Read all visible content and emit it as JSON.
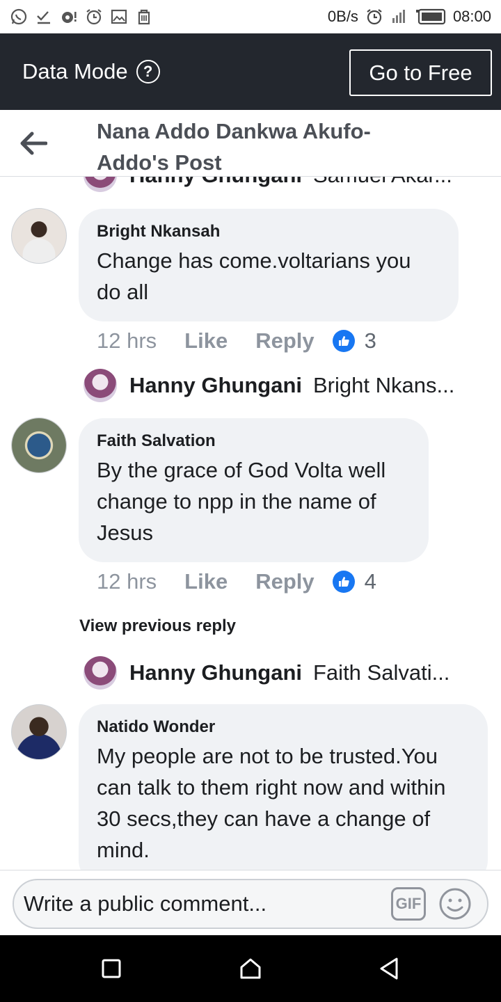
{
  "status_bar": {
    "speed": "0B/s",
    "time": "08:00"
  },
  "data_mode": {
    "label": "Data Mode",
    "help": "?",
    "go_free_label": "Go to Free"
  },
  "header": {
    "title": "Nana Addo Dankwa Akufo-Addo's Post"
  },
  "partial_reply": {
    "name": "Hanny Ghungani",
    "preview": "Samuel Akar..."
  },
  "comments": [
    {
      "author": "Bright Nkansah",
      "text": "Change has come.voltarians you do all",
      "time": "12 hrs",
      "like_label": "Like",
      "reply_label": "Reply",
      "like_count": "3",
      "reply_preview": {
        "name": "Hanny Ghungani",
        "preview": "Bright Nkans..."
      }
    },
    {
      "author": "Faith Salvation",
      "text": "By the grace of God Volta well change to npp in the name of Jesus",
      "time": "12 hrs",
      "like_label": "Like",
      "reply_label": "Reply",
      "like_count": "4",
      "view_previous": "View previous reply",
      "reply_preview": {
        "name": "Hanny Ghungani",
        "preview": "Faith Salvati..."
      }
    },
    {
      "author": "Natido Wonder",
      "text": "My people are not to be trusted.You can talk to them right now and within 30 secs,they can have a change of mind."
    }
  ],
  "composer": {
    "placeholder": "Write a public comment...",
    "gif_label": "GIF"
  },
  "icons": {
    "status_left": [
      "whatsapp-icon",
      "check-icon",
      "notification-icon",
      "alarm-icon",
      "image-icon",
      "trash-icon"
    ],
    "status_right": [
      "alarm-icon",
      "signal-icon",
      "battery-icon"
    ],
    "nav": [
      "recent-apps-icon",
      "home-icon",
      "back-icon"
    ]
  },
  "colors": {
    "data_bar_bg": "#23272e",
    "bubble_bg": "#f0f2f5",
    "like_blue": "#1877f2",
    "muted_text": "#8d949e"
  }
}
